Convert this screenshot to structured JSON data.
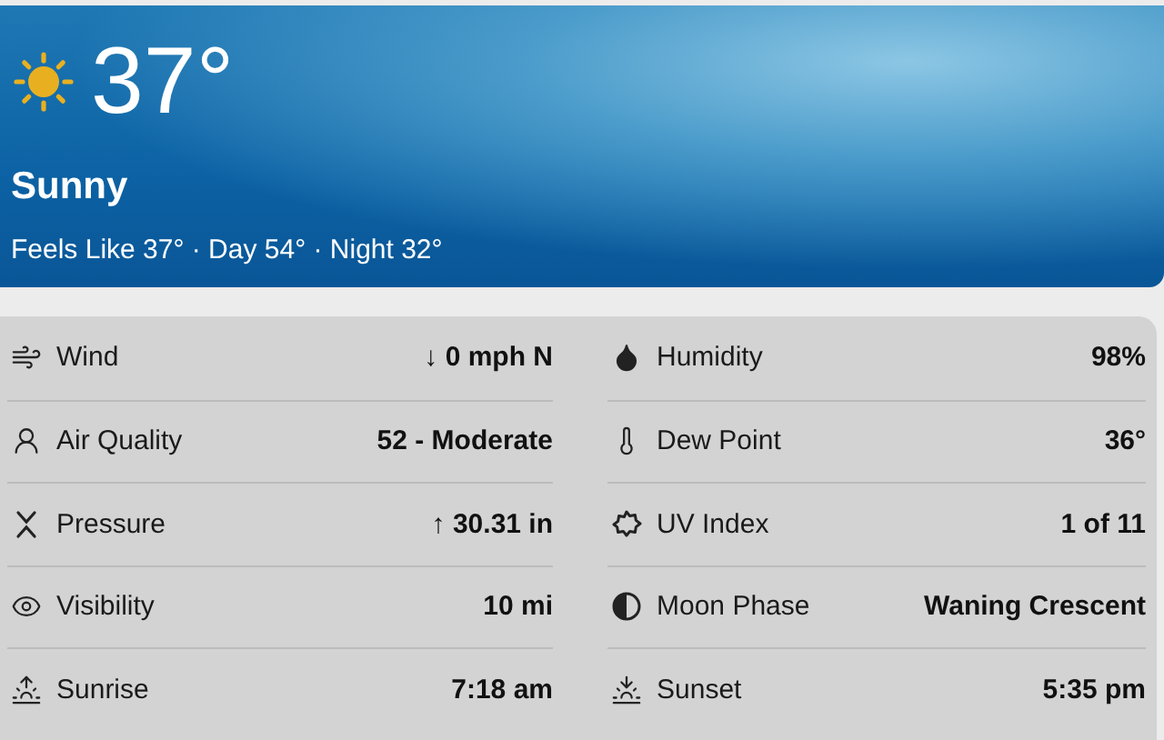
{
  "current": {
    "temperature": "37°",
    "condition": "Sunny",
    "summary": "Feels Like 37° · Day 54° · Night 32°"
  },
  "details": [
    [
      {
        "label": "Wind",
        "value": "↓ 0 mph N"
      },
      {
        "label": "Air Quality",
        "value": "52 - Moderate"
      },
      {
        "label": "Pressure",
        "value": "↑ 30.31 in"
      },
      {
        "label": "Visibility",
        "value": "10 mi"
      },
      {
        "label": "Sunrise",
        "value": "7:18 am"
      }
    ],
    [
      {
        "label": "Humidity",
        "value": "98%"
      },
      {
        "label": "Dew Point",
        "value": "36°"
      },
      {
        "label": "UV Index",
        "value": "1 of 11"
      },
      {
        "label": "Moon Phase",
        "value": "Waning Crescent"
      },
      {
        "label": "Sunset",
        "value": "5:35 pm"
      }
    ]
  ]
}
